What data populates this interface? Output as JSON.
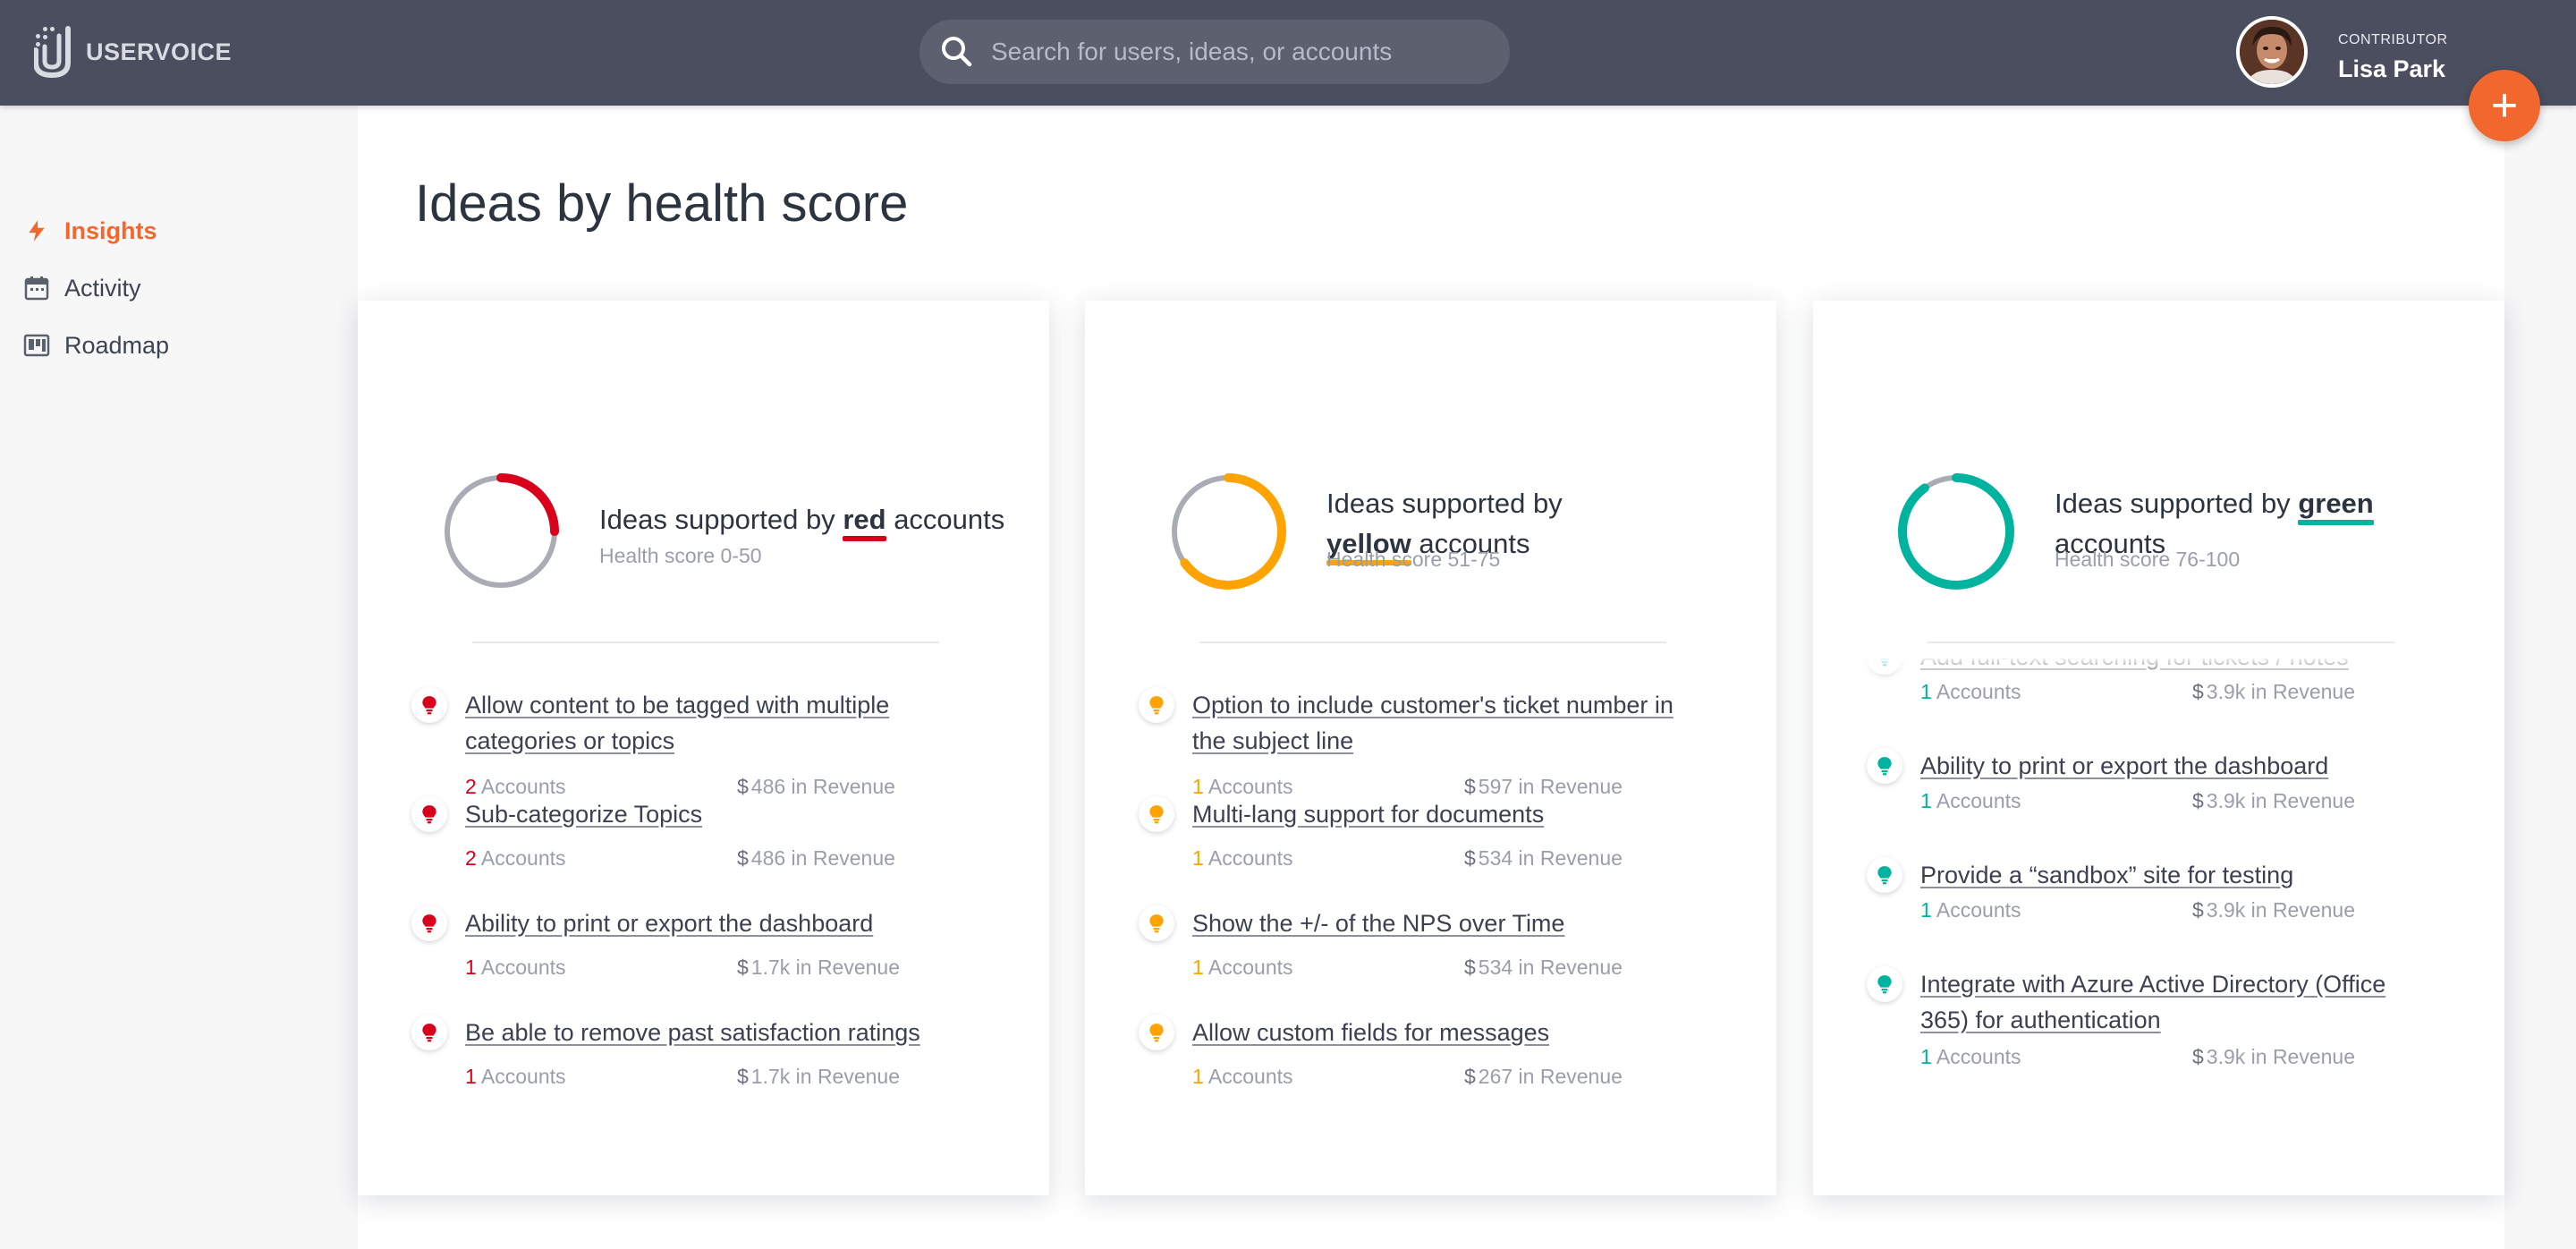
{
  "app": {
    "brand": "USERVOICE"
  },
  "search": {
    "placeholder": "Search for users, ideas, or accounts"
  },
  "user": {
    "role": "CONTRIBUTOR",
    "name": "Lisa Park"
  },
  "fab": {
    "label": "+"
  },
  "sidebar": {
    "items": [
      {
        "label": "Insights",
        "icon": "lightning-icon",
        "active": true
      },
      {
        "label": "Activity",
        "icon": "calendar-icon",
        "active": false
      },
      {
        "label": "Roadmap",
        "icon": "board-icon",
        "active": false
      }
    ]
  },
  "main": {
    "title": "Ideas by health score"
  },
  "colors": {
    "red": "#d9001b",
    "yellow": "#ffa300",
    "green": "#00b39f",
    "accent": "#f2672e",
    "topbar": "#4b4e5e"
  },
  "cards": [
    {
      "heading_prefix": "Ideas supported by",
      "highlight": "red",
      "heading_suffix": "accounts",
      "subtitle": "Health score 0-50",
      "color": "#d9001b",
      "donut_fraction": 0.25,
      "ideas": [
        {
          "title": "Allow content to be tagged with multiple categories or topics",
          "accounts": "2",
          "accounts_label": "Accounts",
          "revenue": "486 in Revenue"
        },
        {
          "title": "Sub-categorize Topics",
          "accounts": "2",
          "accounts_label": "Accounts",
          "revenue": "486 in Revenue"
        },
        {
          "title": "Ability to print or export the dashboard",
          "accounts": "1",
          "accounts_label": "Accounts",
          "revenue": "1.7k in Revenue"
        },
        {
          "title": "Be able to remove past satisfaction ratings",
          "accounts": "1",
          "accounts_label": "Accounts",
          "revenue": "1.7k in Revenue"
        }
      ]
    },
    {
      "heading_prefix": "Ideas supported by",
      "highlight": "yellow",
      "heading_suffix": "accounts",
      "subtitle": "Health score 51-75",
      "color": "#ffa300",
      "donut_fraction": 0.65,
      "ideas": [
        {
          "title": "Option to include customer's ticket number in the subject line",
          "accounts": "1",
          "accounts_label": "Accounts",
          "revenue": "597 in Revenue"
        },
        {
          "title": "Multi-lang support for documents",
          "accounts": "1",
          "accounts_label": "Accounts",
          "revenue": "534 in Revenue"
        },
        {
          "title": "Show the +/- of the NPS over Time",
          "accounts": "1",
          "accounts_label": "Accounts",
          "revenue": "534 in Revenue"
        },
        {
          "title": "Allow custom fields for messages",
          "accounts": "1",
          "accounts_label": "Accounts",
          "revenue": "267 in Revenue"
        }
      ]
    },
    {
      "heading_prefix": "Ideas supported by",
      "highlight": "green",
      "heading_suffix": "accounts",
      "subtitle": "Health score 76-100",
      "color": "#00b39f",
      "donut_fraction": 0.9,
      "ideas": [
        {
          "title": "Add full-text searching for tickets / notes",
          "accounts": "1",
          "accounts_label": "Accounts",
          "revenue": "3.9k in Revenue"
        },
        {
          "title": "Ability to print or export the dashboard",
          "accounts": "1",
          "accounts_label": "Accounts",
          "revenue": "3.9k in Revenue"
        },
        {
          "title": "Provide a “sandbox” site for testing",
          "accounts": "1",
          "accounts_label": "Accounts",
          "revenue": "3.9k in Revenue"
        },
        {
          "title": "Integrate with Azure Active Directory (Office 365) for authentication",
          "accounts": "1",
          "accounts_label": "Accounts",
          "revenue": "3.9k in Revenue"
        }
      ]
    }
  ]
}
